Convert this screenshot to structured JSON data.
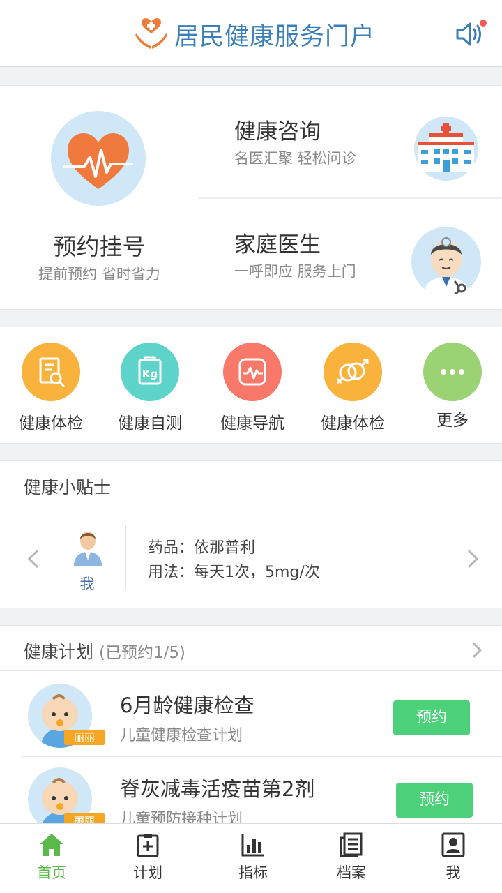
{
  "header": {
    "title": "居民健康服务门户",
    "logo_icon": "hands-heart-icon",
    "speaker_icon": "speaker-icon",
    "accent": "#3a7fb8"
  },
  "services": {
    "registration": {
      "title": "预约挂号",
      "subtitle": "提前预约 省时省力",
      "icon": "heart-pulse-icon"
    },
    "consult": {
      "title": "健康咨询",
      "subtitle": "名医汇聚 轻松问诊",
      "icon": "hospital-icon"
    },
    "family_doctor": {
      "title": "家庭医生",
      "subtitle": "一呼即应 服务上门",
      "icon": "doctor-icon"
    }
  },
  "quick_icons": [
    {
      "label": "健康体检",
      "icon": "report-search-icon",
      "color": "#f9b23c"
    },
    {
      "label": "健康自测",
      "icon": "scale-kg-icon",
      "color": "#5ed3c9"
    },
    {
      "label": "健康导航",
      "icon": "pulse-screen-icon",
      "color": "#f8786a"
    },
    {
      "label": "健康体检",
      "icon": "gender-icon",
      "color": "#f9b23c"
    },
    {
      "label": "更多",
      "icon": "more-dots-icon",
      "color": "#9bd274"
    }
  ],
  "tips": {
    "title": "健康小贴士",
    "person_label": "我",
    "drug": "药品：依那普利",
    "usage": "用法：每天1次，5mg/次"
  },
  "plan": {
    "title": "健康计划",
    "count": "(已预约1/5)",
    "items": [
      {
        "name": "6月龄健康检查",
        "subtitle": "儿童健康检查计划",
        "tag": "丽丽",
        "button": "预约"
      },
      {
        "name": "脊灰减毒活疫苗第2剂",
        "subtitle": "儿童预防接种计划",
        "tag": "丽丽",
        "button": "预约"
      }
    ]
  },
  "nav": {
    "tabs": [
      {
        "label": "首页",
        "icon": "home-icon",
        "active": true
      },
      {
        "label": "计划",
        "icon": "clipboard-plus-icon"
      },
      {
        "label": "指标",
        "icon": "bar-chart-icon"
      },
      {
        "label": "档案",
        "icon": "document-icon"
      },
      {
        "label": "我",
        "icon": "contact-card-icon"
      }
    ],
    "active_color": "#5bb84a"
  }
}
